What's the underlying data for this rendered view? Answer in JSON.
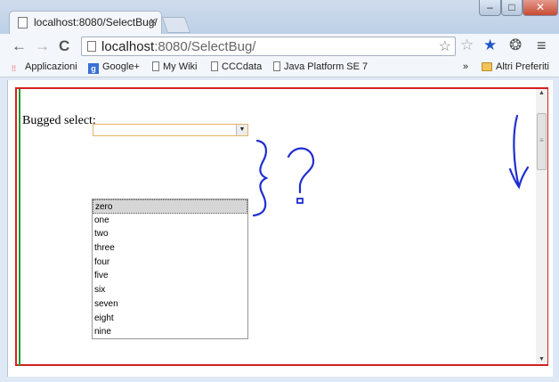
{
  "tab": {
    "title": "localhost:8080/SelectBug/",
    "close": "×"
  },
  "window_controls": {
    "minimize": "–",
    "maximize": "□",
    "close": "✕"
  },
  "toolbar": {
    "back": "←",
    "forward": "→",
    "reload": "C",
    "url_host": "localhost",
    "url_rest": ":8080/SelectBug/",
    "menu": "≡"
  },
  "bookmarks": {
    "items": [
      "Applicazioni",
      "Google+",
      "My Wiki",
      "CCCdata",
      "Java Platform SE 7"
    ],
    "overflow": "»",
    "other": "Altri Preferiti"
  },
  "page": {
    "label": "Bugged select:",
    "select_value": "",
    "options": [
      "zero",
      "one",
      "two",
      "three",
      "four",
      "five",
      "six",
      "seven",
      "eight",
      "nine"
    ],
    "highlighted_index": 0
  },
  "colors": {
    "frame_outer": "#d42020",
    "frame_inner": "#1e9a2a",
    "annotation_ink": "#1f2fd0",
    "select_border": "#e3b56a"
  },
  "icons": [
    "back-icon",
    "forward-icon",
    "reload-icon",
    "bookmark-star-icon",
    "filled-star-icon",
    "extension-icon",
    "menu-icon",
    "page-icon",
    "folder-icon"
  ]
}
